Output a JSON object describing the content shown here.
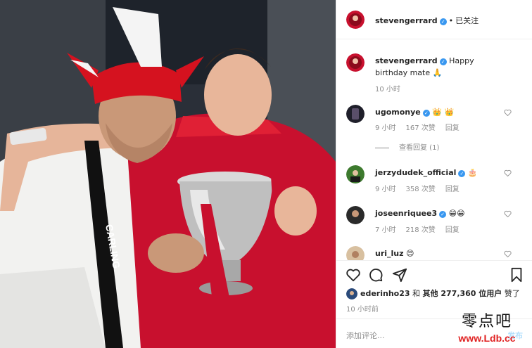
{
  "header": {
    "username": "stevengerrard",
    "verified_mark": "✓",
    "separator": "•",
    "follow_status": "已关注"
  },
  "caption": {
    "username": "stevengerrard",
    "text": "Happy birthday mate 🙏",
    "time": "10 小时"
  },
  "comments": [
    {
      "username": "ugomonye",
      "text": "👑 👑",
      "time": "9 小时",
      "likes": "167 次赞",
      "reply": "回复",
      "view_replies": "查看回复 (1)"
    },
    {
      "username": "jerzydudek_official",
      "text": "🎂",
      "time": "9 小时",
      "likes": "358 次赞",
      "reply": "回复"
    },
    {
      "username": "joseenriquee3",
      "text": "😁😁",
      "time": "7 小时",
      "likes": "218 次赞",
      "reply": "回复"
    },
    {
      "username": "uri_luz",
      "text": "😍"
    }
  ],
  "actions": {
    "like_icon": "heart-icon",
    "comment_icon": "comment-icon",
    "share_icon": "share-icon",
    "save_icon": "bookmark-icon"
  },
  "likes": {
    "user": "ederinho23",
    "and_others": "和",
    "others_bold": "其他 277,360 位用户",
    "liked": "赞了"
  },
  "post_time": "10 小时前",
  "add_comment": {
    "placeholder": "添加评论...",
    "post_label": "发布"
  },
  "watermark": {
    "chinese": "零点吧",
    "url": "www.Ldb.cc"
  },
  "colors": {
    "verified_blue": "#3897f0",
    "liverpool_red": "#c8102e",
    "muted_text": "#8e8e8e",
    "watermark_red": "#e02020"
  }
}
